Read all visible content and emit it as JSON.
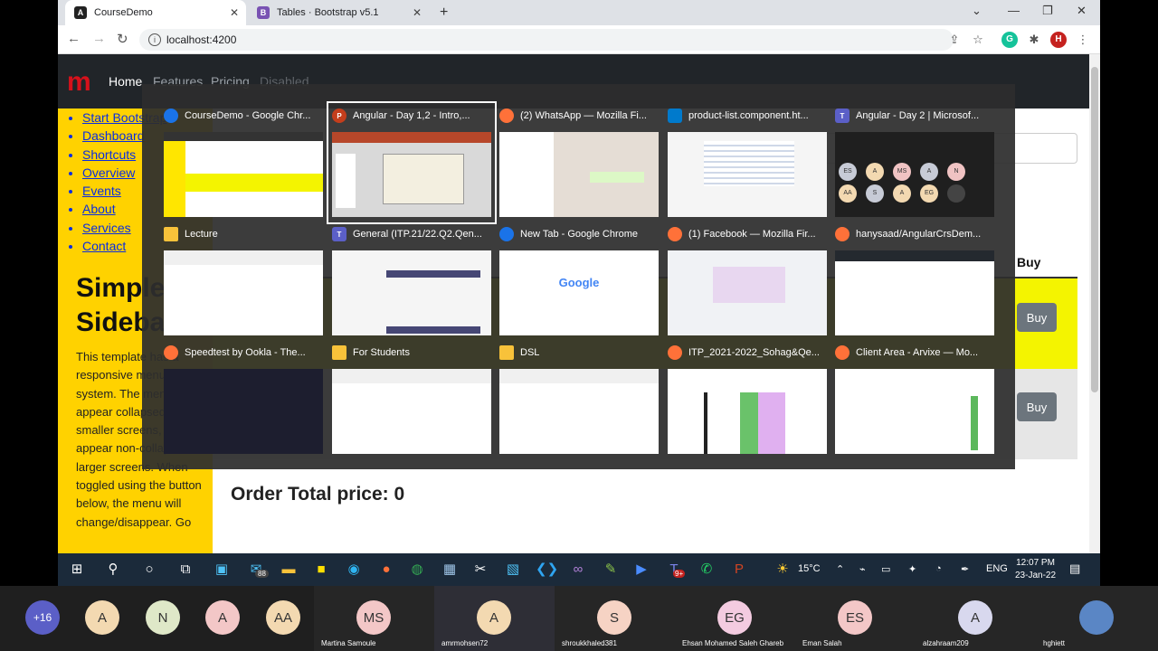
{
  "browser": {
    "tabs": [
      {
        "title": "CourseDemo",
        "icon": "angular-icon"
      },
      {
        "title": "Tables · Bootstrap v5.1",
        "icon": "bootstrap-icon"
      }
    ],
    "url": "localhost:4200",
    "profile_initial": "H"
  },
  "app": {
    "nav": [
      "Home",
      "Features",
      "Pricing",
      "Disabled"
    ],
    "sidebar_links": [
      "Start Bootstrap",
      "Dashboard",
      "Shortcuts",
      "Overview",
      "Events",
      "About",
      "Services",
      "Contact"
    ],
    "sidebar_title": "Simple Sidebar",
    "sidebar_text": "This template has a responsive menu toggling system. The menu will appear collapsed on smaller screens, and will appear non-collapsed on larger screens. When toggled using the button below, the menu will change/disappear. Go",
    "table_header_buy": "Buy",
    "buy_label": "Buy",
    "order_total": "Order Total price: 0"
  },
  "task_switcher": {
    "windows": [
      {
        "title": "CourseDemo - Google Chr...",
        "icon": "chrome-icon"
      },
      {
        "title": "Angular - Day 1,2 - Intro,...",
        "icon": "powerpoint-icon"
      },
      {
        "title": "(2) WhatsApp — Mozilla Fi...",
        "icon": "firefox-icon"
      },
      {
        "title": "product-list.component.ht...",
        "icon": "vscode-icon"
      },
      {
        "title": "Angular - Day 2 | Microsof...",
        "icon": "teams-icon"
      },
      {
        "title": "Lecture",
        "icon": "folder-icon"
      },
      {
        "title": "General (ITP.21/22.Q2.Qen...",
        "icon": "teams-icon"
      },
      {
        "title": "New Tab - Google Chrome",
        "icon": "chrome-icon"
      },
      {
        "title": "(1) Facebook — Mozilla Fir...",
        "icon": "firefox-icon"
      },
      {
        "title": "hanysaad/AngularCrsDem...",
        "icon": "firefox-icon"
      },
      {
        "title": "Speedtest by Ookla - The...",
        "icon": "firefox-icon"
      },
      {
        "title": "For Students",
        "icon": "folder-icon"
      },
      {
        "title": "DSL",
        "icon": "folder-icon"
      },
      {
        "title": "ITP_2021-2022_Sohag&Qe...",
        "icon": "firefox-icon"
      },
      {
        "title": "Client Area - Arvixe — Mo...",
        "icon": "firefox-icon"
      }
    ],
    "google_logo_text": "Google",
    "teams_avatars": [
      "ES",
      "A",
      "MS",
      "A",
      "N",
      "AA",
      "S",
      "A",
      "EG",
      ""
    ]
  },
  "taskbar": {
    "mail_badge": "88",
    "teams_badge": "9+",
    "weather": "15°C",
    "language": "ENG",
    "time": "12:07 PM",
    "date": "23-Jan-22"
  },
  "meeting": {
    "more_count": "+16",
    "participants": [
      {
        "initials": "A",
        "name": ""
      },
      {
        "initials": "N",
        "name": ""
      },
      {
        "initials": "A",
        "name": ""
      },
      {
        "initials": "AA",
        "name": ""
      },
      {
        "initials": "MS",
        "name": "Martina Samoule"
      },
      {
        "initials": "A",
        "name": "amrmohsen72"
      },
      {
        "initials": "S",
        "name": "shroukkhaled381"
      },
      {
        "initials": "EG",
        "name": "Ehsan Mohamed Saleh Ghareb"
      },
      {
        "initials": "ES",
        "name": "Eman Salah"
      },
      {
        "initials": "A",
        "name": "alzahraam209"
      },
      {
        "initials": "",
        "name": "hghiett"
      }
    ]
  },
  "colors": {
    "sidebar": "#ffd200",
    "table_row_highlight": "#f4f400",
    "navbar": "#212529",
    "link": "#0a2de0",
    "taskbar": "#1b2a3a"
  }
}
